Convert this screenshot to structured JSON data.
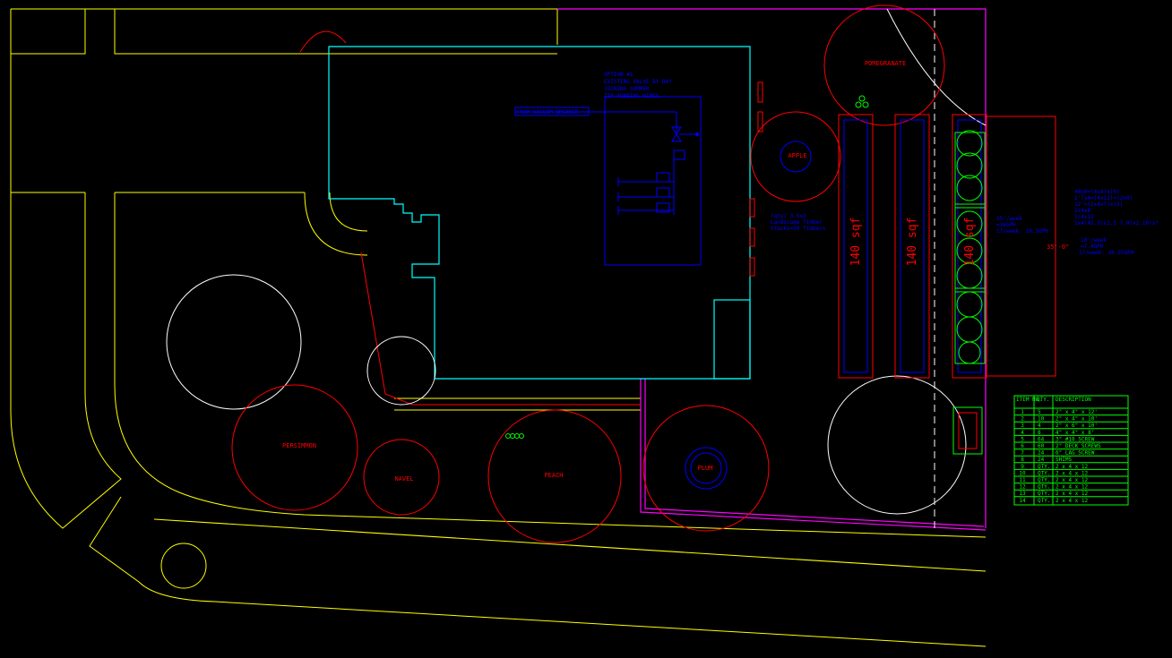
{
  "colors": {
    "background": "#000000",
    "site": "#ffff00",
    "building": "#00ffff",
    "boundary": "#ff00ff",
    "tree": "#ff0000",
    "existing_tree": "#ffffff",
    "irrigation": "#0000ff",
    "lumber": "#00ff00"
  },
  "trees": {
    "pomegranate": "POMEGRANATE",
    "apple": "APPLE",
    "persimmon": "PERSIMMON",
    "navel": "NAVEL",
    "peach": "PEACH",
    "plum": "PLUM"
  },
  "beds": {
    "bed1_area": "140 sqf",
    "bed2_area": "140 sqf",
    "bed3_area": "140 sqf"
  },
  "irrigation": {
    "notes": [
      "OPTION #1",
      "EXISTING VALVE BY-DAY",
      "JOINING SUMMER",
      "ZIP RUBBING WIRES"
    ],
    "from_label": "FROM VACUUM BREAKER"
  },
  "planter_notes": [
    "(qty) 3-5x3",
    "Landscape Timber",
    "Stacks=20 Timbers"
  ],
  "bed_notes": {
    "right_block": [
      "40x0=(4x4)x(0)",
      "2'7x4=(4x12)=(2x0)",
      "12'=(2x4x?)x(3)",
      "2x4x8'",
      "1/4x12",
      "1x4(42.5)x2.5 7.8(x2.10)x?"
    ],
    "runtime_a": [
      "25'/week",
      "=36GPH",
      "17/week: 10.5GPH"
    ],
    "runtime_b": [
      "10'/week",
      "=7.4GPH",
      "17/week: 10.25GPH"
    ],
    "dimension": "35'-0\""
  },
  "table": {
    "headers": [
      "ITEM NO.",
      "QTY.",
      "DESCRIPTION"
    ],
    "rows": [
      [
        "1",
        "5",
        "2\" x 4\" x 12'"
      ],
      [
        "2",
        "10",
        "2\" x 4\" x 10'"
      ],
      [
        "3",
        "4",
        "2\" x 6\" x 10'"
      ],
      [
        "4",
        "8",
        "4\" x 4\" x 8'"
      ],
      [
        "5",
        "64",
        "3\" #10 SCREW"
      ],
      [
        "6",
        "60",
        "2\" DECK SCREWS"
      ],
      [
        "7",
        "24",
        "6\" LAG SCREW"
      ],
      [
        "8",
        "24",
        "SHIMS"
      ],
      [
        "9",
        "QTY.",
        "2 x 4 x 12"
      ],
      [
        "10",
        "QTY.",
        "2 x 4 x 12"
      ],
      [
        "11",
        "QTY.",
        "2 x 4 x 12"
      ],
      [
        "12",
        "QTY.",
        "2 x 4 x 12"
      ],
      [
        "13",
        "QTY.",
        "2 x 4 x 12"
      ],
      [
        "14",
        "QTY.",
        "2 x 4 x 12"
      ]
    ]
  }
}
